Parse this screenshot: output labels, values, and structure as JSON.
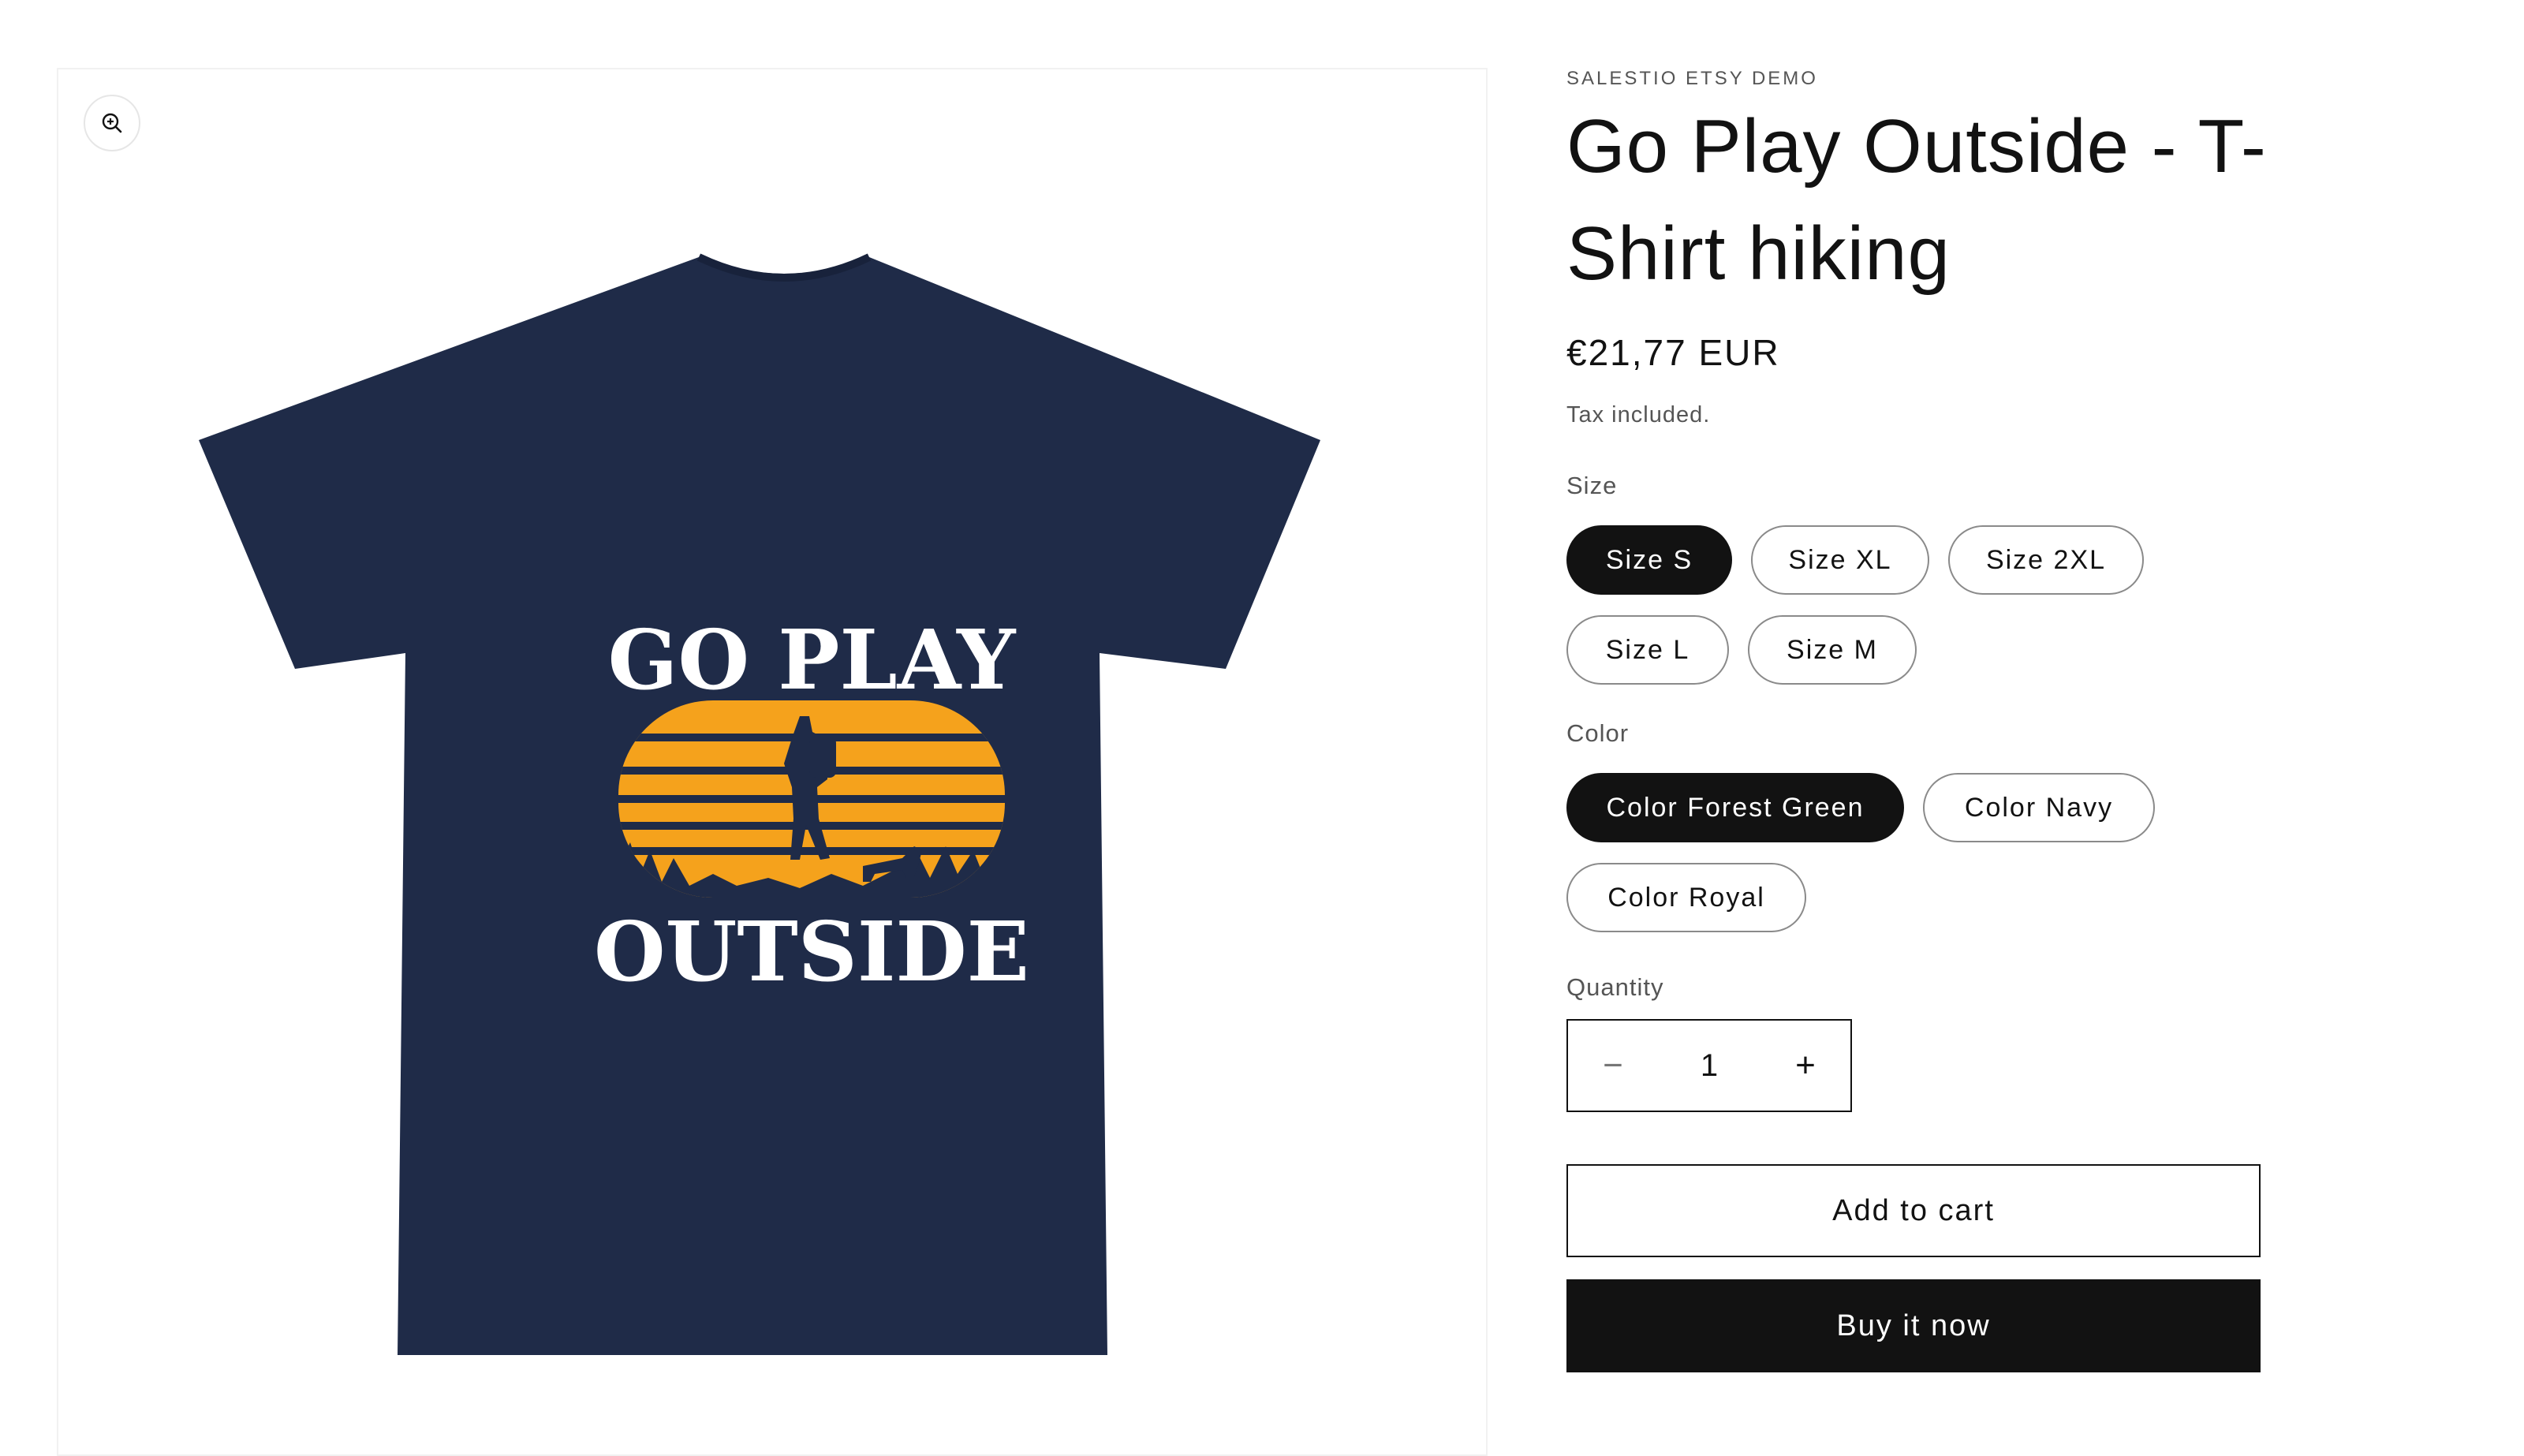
{
  "gallery": {
    "zoom_icon": "zoom-in-icon",
    "image_alt": "Go Play Outside - T-Shirt hiking",
    "shirt_color": "#1f2b48",
    "sunset_color": "#f5a21c",
    "print_text_line1": "GO PLAY",
    "print_text_line2": "OUTSIDE"
  },
  "product": {
    "vendor": "SALESTIO ETSY DEMO",
    "title": "Go Play Outside - T-Shirt hiking",
    "price": "€21,77 EUR",
    "tax_note": "Tax included."
  },
  "size": {
    "label": "Size",
    "options": [
      "Size S",
      "Size XL",
      "Size 2XL",
      "Size L",
      "Size M"
    ],
    "selected": "Size S"
  },
  "color": {
    "label": "Color",
    "options": [
      "Color Forest Green",
      "Color Navy",
      "Color Royal"
    ],
    "selected": "Color Forest Green"
  },
  "quantity": {
    "label": "Quantity",
    "value": "1",
    "minus_icon": "minus-icon",
    "plus_icon": "plus-icon",
    "minus_symbol": "−",
    "plus_symbol": "+"
  },
  "actions": {
    "add_to_cart": "Add to cart",
    "buy_now": "Buy it now"
  },
  "colors": {
    "primary": "#121212",
    "muted_text": "#555555"
  }
}
